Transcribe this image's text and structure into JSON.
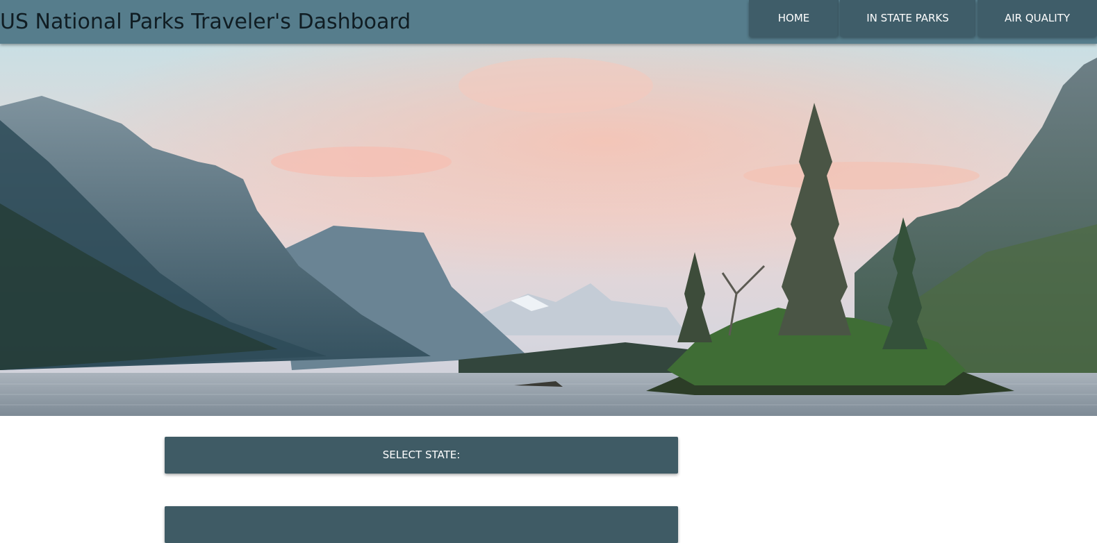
{
  "header": {
    "title": "US National Parks Traveler's Dashboard",
    "nav": [
      {
        "label": "HOME"
      },
      {
        "label": "IN STATE PARKS"
      },
      {
        "label": "AIR QUALITY"
      }
    ]
  },
  "hero": {
    "icon": "mountain-lake-landscape"
  },
  "controls": {
    "select_state_label": "SELECT STATE:"
  },
  "colors": {
    "navbar": "#567d8c",
    "nav_button": "#3f5d69",
    "panel": "#3f5b65",
    "title_text": "#101d23"
  }
}
